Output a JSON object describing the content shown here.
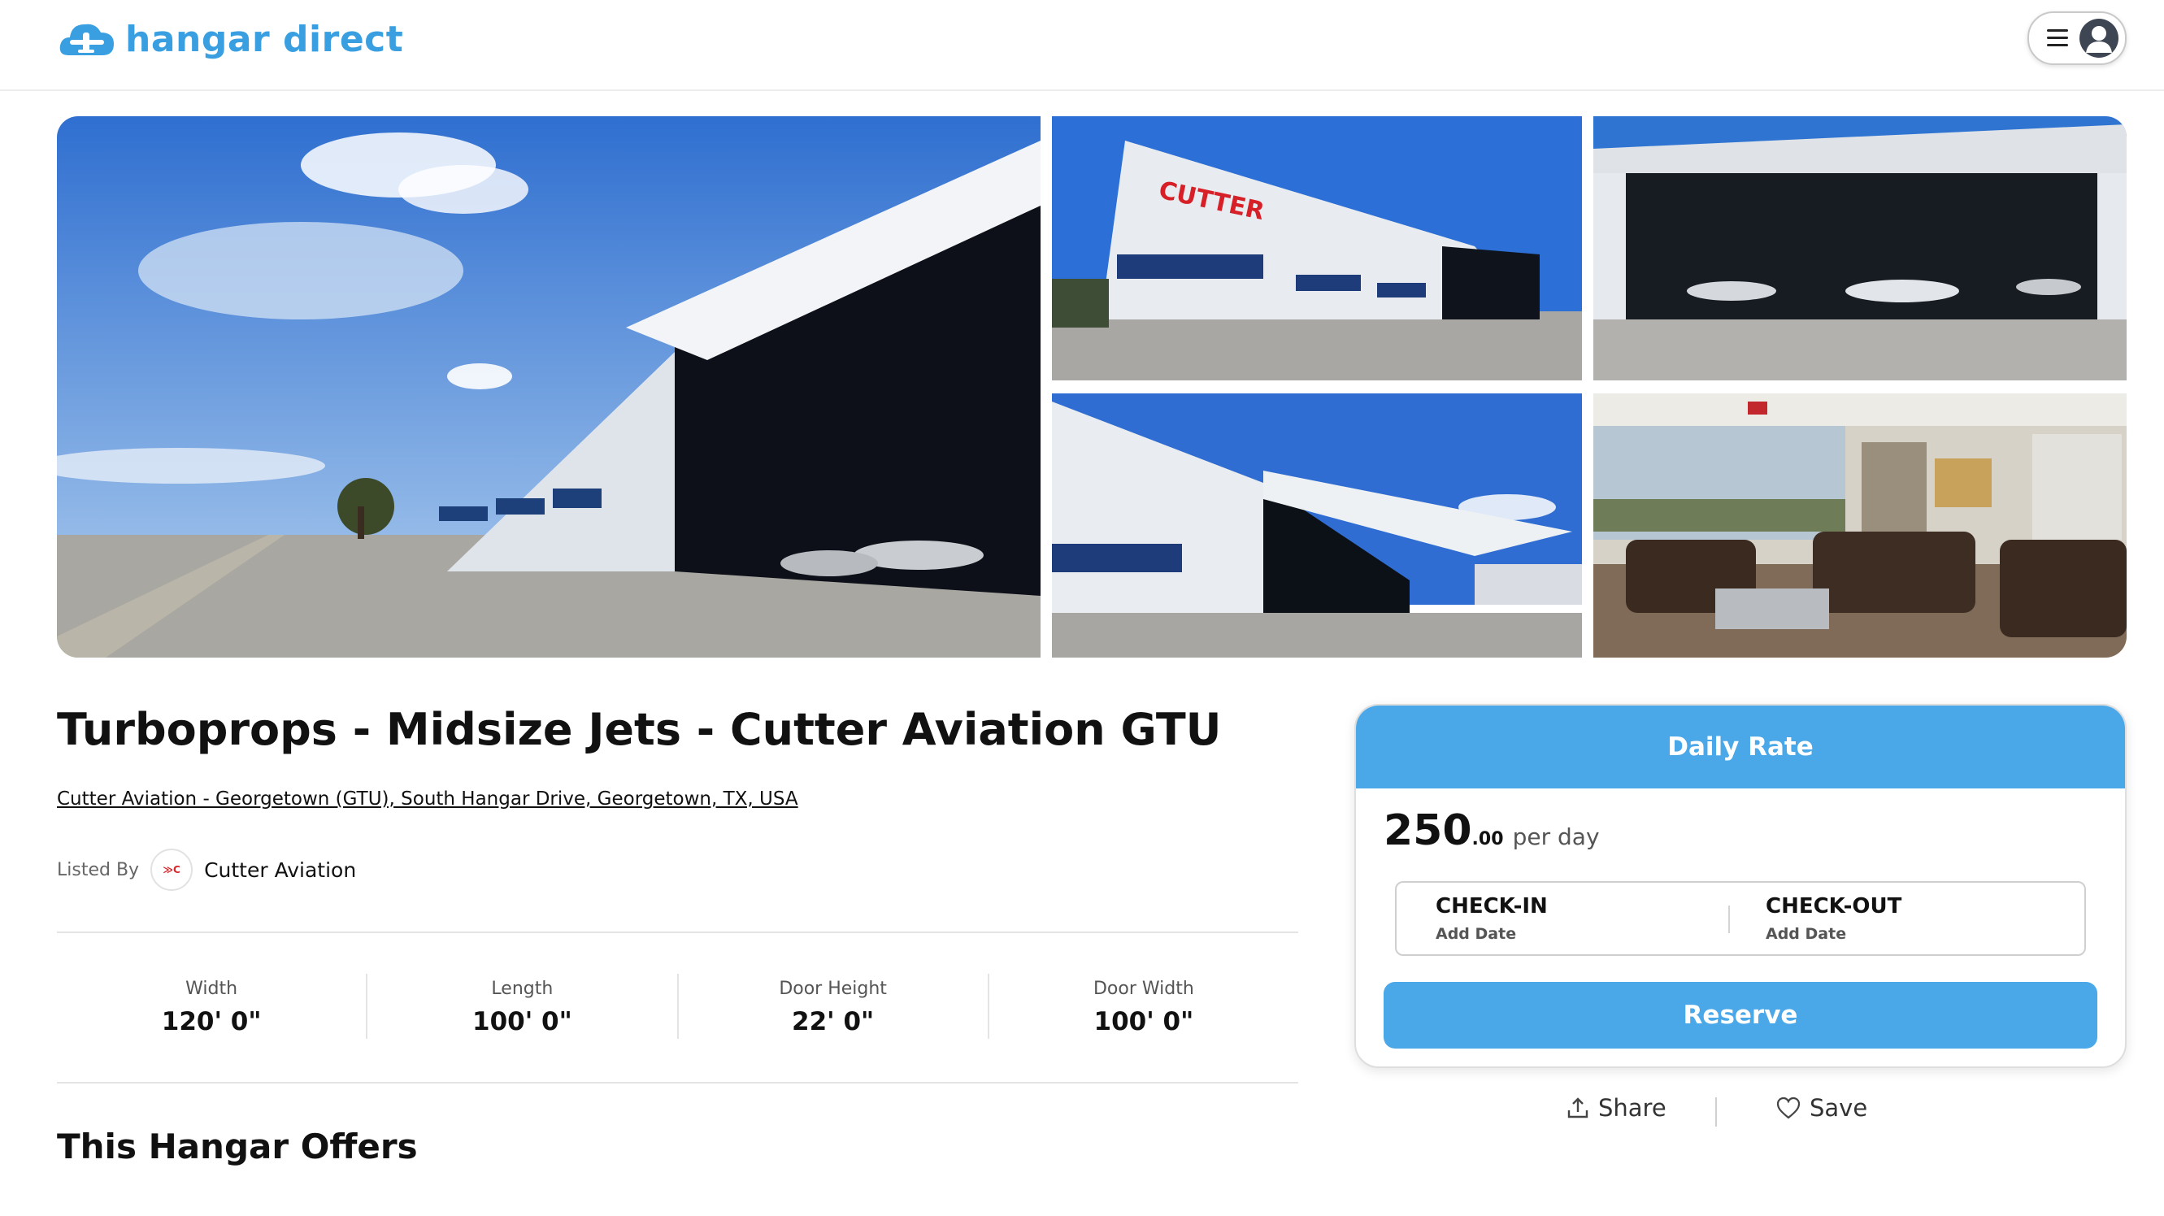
{
  "header": {
    "brand": "hangar direct",
    "logo_icon": "airplane-cloud-icon",
    "menu_icon": "hamburger-icon",
    "avatar_icon": "user-avatar-icon",
    "brand_color": "#3a9fe0"
  },
  "gallery": {
    "photos": [
      {
        "name": "hangar-exterior-wide"
      },
      {
        "name": "cutter-building-front"
      },
      {
        "name": "hangar-interior-jets"
      },
      {
        "name": "hangar-side-view"
      },
      {
        "name": "lounge-interior"
      }
    ]
  },
  "listing": {
    "title": "Turboprops - Midsize Jets - Cutter Aviation GTU",
    "address": "Cutter Aviation - Georgetown (GTU), South Hangar Drive, Georgetown, TX, USA",
    "listed_by_label": "Listed By",
    "host_name": "Cutter Aviation",
    "host_logo_text": "≫C"
  },
  "specs": [
    {
      "label": "Width",
      "value": "120' 0\""
    },
    {
      "label": "Length",
      "value": "100' 0\""
    },
    {
      "label": "Door Height",
      "value": "22' 0\""
    },
    {
      "label": "Door Width",
      "value": "100' 0\""
    }
  ],
  "offers_heading": "This Hangar Offers",
  "booking": {
    "header": "Daily Rate",
    "price_int": "250",
    "price_dec": ".00",
    "price_unit": "per day",
    "check_in_label": "CHECK-IN",
    "check_in_value": "Add Date",
    "check_out_label": "CHECK-OUT",
    "check_out_value": "Add Date",
    "reserve_label": "Reserve",
    "accent_color": "#4aa8e8"
  },
  "actions": {
    "share_label": "Share",
    "share_icon": "upload-share-icon",
    "save_label": "Save",
    "save_icon": "heart-icon"
  }
}
